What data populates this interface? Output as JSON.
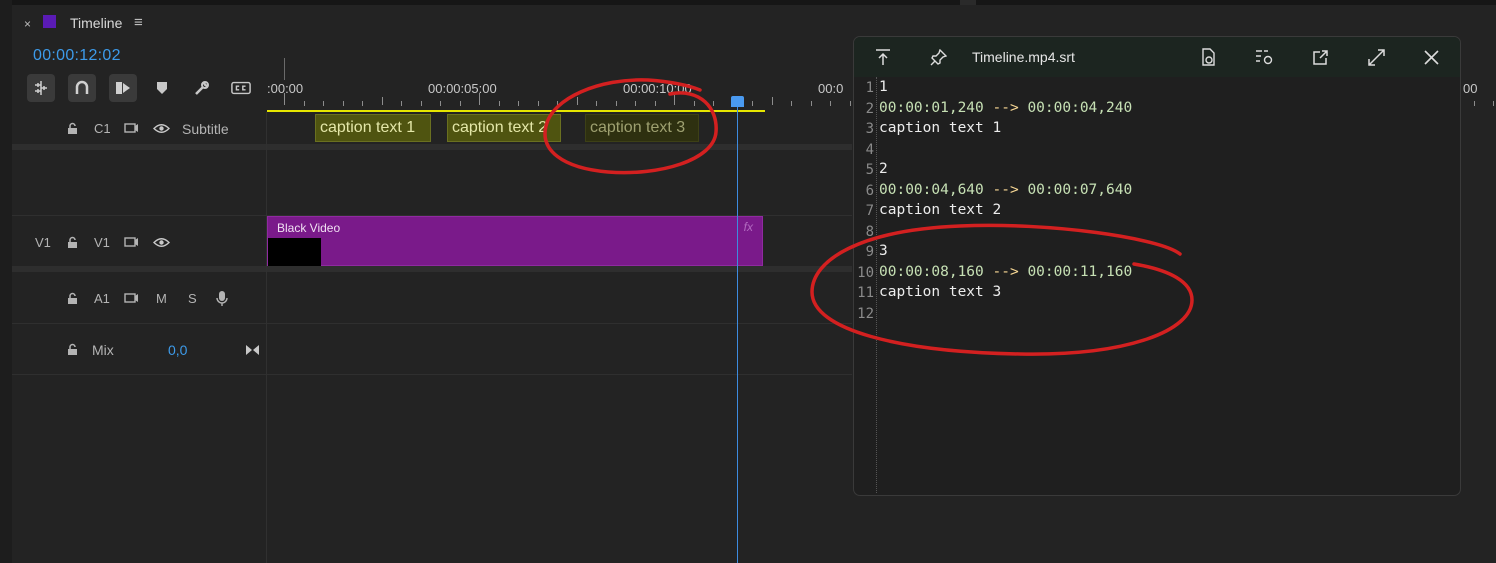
{
  "panel": {
    "tab_close": "×",
    "tab_title": "Timeline",
    "tab_menu": "≡",
    "swatch_color": "#5a1bb5",
    "timecode": "00:00:12:02"
  },
  "toolbar": {
    "icons": [
      "insert-sequence-icon",
      "snap-magnet-icon",
      "linked-selection-icon",
      "marker-icon",
      "wrench-icon",
      "captions-icon"
    ]
  },
  "ruler": {
    "labels": [
      ":00:00",
      "00:00:05:00",
      "00:00:10:00",
      "00:0",
      "00"
    ]
  },
  "tracks": {
    "c1": {
      "target": "C1",
      "name": "Subtitle"
    },
    "v1": {
      "source": "V1",
      "target": "V1"
    },
    "a1": {
      "target": "A1",
      "mute": "M",
      "solo": "S"
    },
    "mix": {
      "label": "Mix",
      "value": "0,0"
    }
  },
  "clips": {
    "captions": [
      "caption text 1",
      "caption text 2",
      "caption text 3"
    ],
    "video": {
      "label": "Black Video",
      "fx": "fx",
      "color": "#7a1a8a"
    }
  },
  "notepad": {
    "title": "Timeline.mp4.srt",
    "icons": [
      "go-to-top-icon",
      "pin-icon",
      "file-settings-icon",
      "list-settings-icon",
      "share-icon",
      "expand-icon",
      "close-icon"
    ],
    "line_numbers": [
      "1",
      "2",
      "3",
      "4",
      "5",
      "6",
      "7",
      "8",
      "9",
      "10",
      "11",
      "12"
    ],
    "lines": [
      {
        "text": "1"
      },
      {
        "start": "00:00:01,240",
        "arrow": "-->",
        "end": "00:00:04,240"
      },
      {
        "text": "caption text 1"
      },
      {
        "text": ""
      },
      {
        "text": "2"
      },
      {
        "start": "00:00:04,640",
        "arrow": "-->",
        "end": "00:00:07,640"
      },
      {
        "text": "caption text 2"
      },
      {
        "text": ""
      },
      {
        "text": "3"
      },
      {
        "start": "00:00:08,160",
        "arrow": "-->",
        "end": "00:00:11,160"
      },
      {
        "text": "caption text 3"
      },
      {
        "text": ""
      }
    ]
  },
  "colors": {
    "accent_timecode": "#3d9bea",
    "playhead": "#4a9af0",
    "caption_clip": "#4f5410",
    "annotation": "#d32020"
  }
}
